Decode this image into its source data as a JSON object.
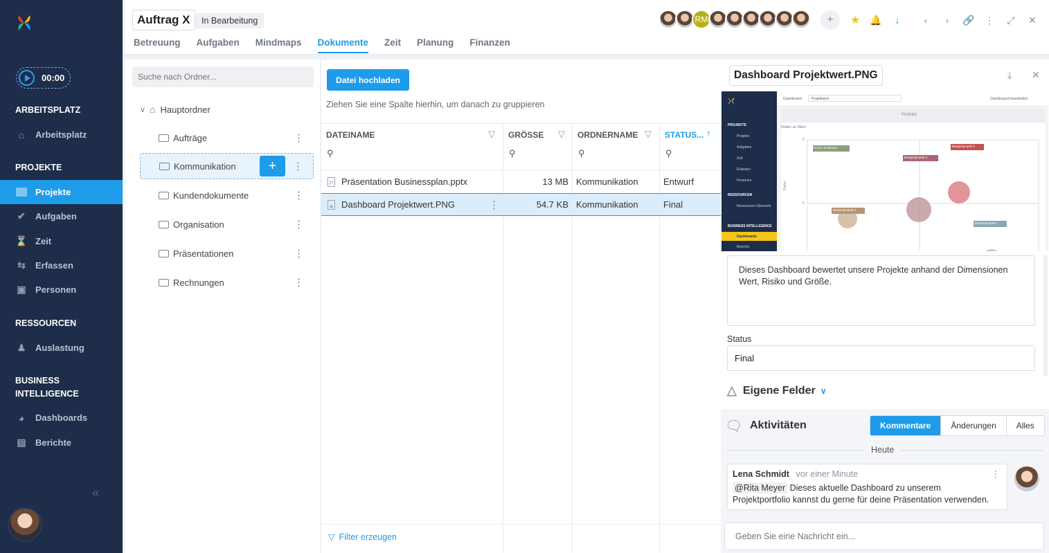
{
  "sidebar": {
    "timer": "00:00",
    "sections": {
      "arbeitsplatz": "ARBEITSPLATZ",
      "projekte": "PROJEKTE",
      "ressourcen": "RESSOURCEN",
      "bi": "BUSINESS INTELLIGENCE"
    },
    "items": [
      {
        "label": "Arbeitsplatz",
        "icon": "home-icon"
      },
      {
        "label": "Projekte",
        "icon": "folder-icon",
        "active": true
      },
      {
        "label": "Aufgaben",
        "icon": "check-circle-icon"
      },
      {
        "label": "Zeit",
        "icon": "hourglass-icon"
      },
      {
        "label": "Erfassen",
        "icon": "transfer-icon"
      },
      {
        "label": "Personen",
        "icon": "contact-card-icon"
      },
      {
        "label": "Auslastung",
        "icon": "workload-icon"
      },
      {
        "label": "Dashboards",
        "icon": "pie-chart-icon"
      },
      {
        "label": "Berichte",
        "icon": "report-icon"
      }
    ]
  },
  "header": {
    "title": "Auftrag X",
    "status": "In Bearbeitung",
    "tabs": [
      "Betreuung",
      "Aufgaben",
      "Mindmaps",
      "Dokumente",
      "Zeit",
      "Planung",
      "Finanzen"
    ],
    "active_tab": "Dokumente",
    "member_initials": "RM"
  },
  "folders": {
    "search_placeholder": "Suche nach Ordner...",
    "root": "Hauptordner",
    "items": [
      "Aufträge",
      "Kommunikation",
      "Kundendokumente",
      "Organisation",
      "Präsentationen",
      "Rechnungen"
    ],
    "selected": "Kommunikation"
  },
  "grid": {
    "upload_label": "Datei hochladen",
    "group_hint": "Ziehen Sie eine Spalte hierhin, um danach zu gruppieren",
    "columns": [
      "DATEINAME",
      "GRÖSSE",
      "ORDNERNAME",
      "STATUS..."
    ],
    "rows": [
      {
        "name": "Präsentation Businessplan.pptx",
        "size": "13 MB",
        "folder": "Kommunikation",
        "status": "Entwurf"
      },
      {
        "name": "Dashboard Projektwert.PNG",
        "size": "54.7 KB",
        "folder": "Kommunikation",
        "status": "Final"
      }
    ],
    "filter_label": "Filter erzeugen"
  },
  "detail": {
    "title": "Dashboard Projektwert.PNG",
    "preview": {
      "header_label": "Dashboard",
      "select_value": "Projektwert",
      "edit_label": "Dashboard bearbeiten",
      "panel_title": "Portfolio",
      "chart_title": "Risiko zu Wert",
      "nav_section_1": "PROJEKTE",
      "nav_items_1": [
        "Projekte",
        "Aufgaben",
        "Zeit",
        "Erfassen",
        "Personen"
      ],
      "nav_section_2": "RESSOURCEN",
      "nav_items_2": [
        "Ressourcen-Übersicht"
      ],
      "nav_section_3": "BUSINESS INTELLIGENCE",
      "nav_active": "Dashboards",
      "nav_partial": "Berichte",
      "axis_top": "0",
      "axis_mid": "5",
      "yaxis_label": "Risiko",
      "bubbles": [
        "InLoox Testphase",
        "Beispielprojekt 4",
        "Beispielprojekt 2",
        "Beispielprojekt 3",
        "Beispielprojekt 1"
      ]
    },
    "description": "Dieses Dashboard bewertet unsere Projekte anhand der Dimensionen Wert, Risiko und Größe.",
    "status_label": "Status",
    "status_value": "Final",
    "custom_fields": "Eigene Felder",
    "activities": {
      "title": "Aktivitäten",
      "tabs": [
        "Kommentare",
        "Änderungen",
        "Alles"
      ],
      "day": "Heute",
      "comment": {
        "author": "Lena Schmidt",
        "time": "vor einer Minute",
        "mention": "@Rita Meyer",
        "text_1": "Dieses aktuelle Dashboard zu unserem",
        "text_2": "Projektportfolio kannst du gerne für deine Präsentation verwenden."
      },
      "message_placeholder": "Geben Sie eine Nachricht ein..."
    }
  },
  "colors": {
    "accent": "#1e9be9",
    "sidebar": "#1d2d4a",
    "star": "#f5c518"
  }
}
